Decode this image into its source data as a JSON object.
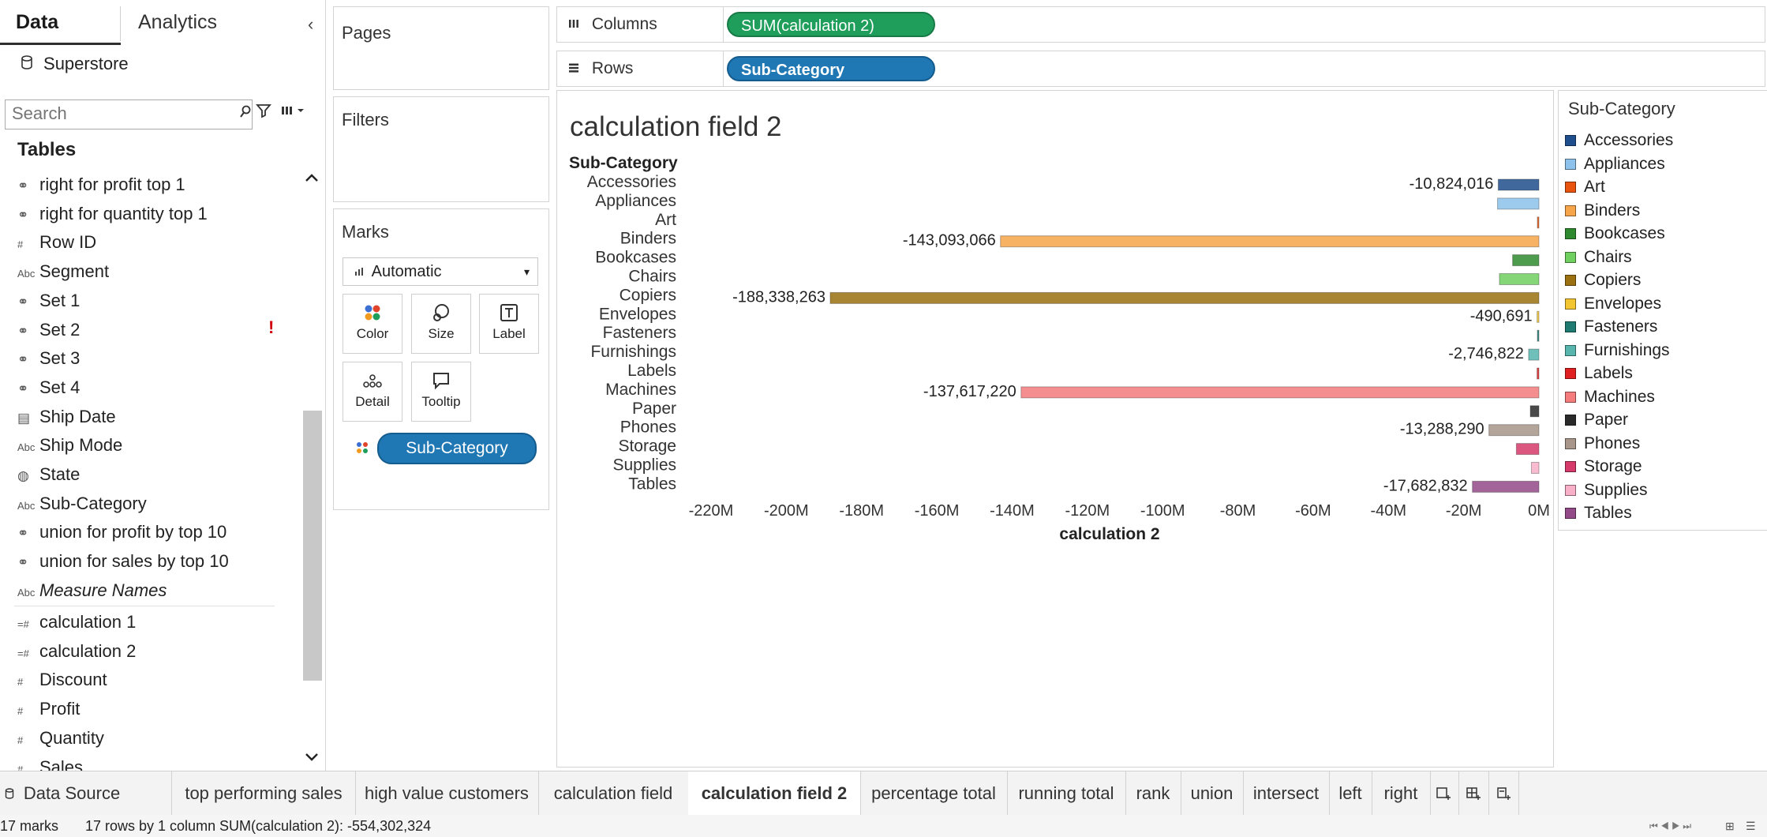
{
  "left_pane": {
    "tabs": {
      "data": "Data",
      "analytics": "Analytics"
    },
    "collapse_glyph": "‹",
    "datasource": "Superstore",
    "search_placeholder": "Search",
    "tables_header": "Tables",
    "fields": [
      {
        "icon": "link",
        "label": "right for profit top 1"
      },
      {
        "icon": "link",
        "label": "right for quantity top 1"
      },
      {
        "icon": "#",
        "label": "Row ID"
      },
      {
        "icon": "Abc",
        "label": "Segment"
      },
      {
        "icon": "link",
        "label": "Set 1"
      },
      {
        "icon": "link",
        "label": "Set 2"
      },
      {
        "icon": "link",
        "label": "Set 3"
      },
      {
        "icon": "link",
        "label": "Set 4"
      },
      {
        "icon": "date",
        "label": "Ship Date"
      },
      {
        "icon": "Abc",
        "label": "Ship Mode"
      },
      {
        "icon": "globe",
        "label": "State"
      },
      {
        "icon": "Abc",
        "label": "Sub-Category"
      },
      {
        "icon": "link",
        "label": "union for profit by top 10"
      },
      {
        "icon": "link",
        "label": "union for sales by top 10"
      },
      {
        "icon": "Abc",
        "label": "Measure Names",
        "italic": true
      },
      {
        "icon": "=#",
        "label": "calculation 1"
      },
      {
        "icon": "=#",
        "label": "calculation 2"
      },
      {
        "icon": "#",
        "label": "Discount"
      },
      {
        "icon": "#",
        "label": "Profit"
      },
      {
        "icon": "#",
        "label": "Quantity"
      },
      {
        "icon": "#",
        "label": "Sales"
      }
    ],
    "warning_glyph": "!"
  },
  "cards": {
    "pages": "Pages",
    "filters": "Filters",
    "marks": "Marks",
    "mark_type": "Automatic",
    "mark_buttons": [
      {
        "label": "Color",
        "icon": "color-icon"
      },
      {
        "label": "Size",
        "icon": "size-icon"
      },
      {
        "label": "Label",
        "icon": "label-icon"
      },
      {
        "label": "Detail",
        "icon": "detail-icon"
      },
      {
        "label": "Tooltip",
        "icon": "tooltip-icon"
      }
    ],
    "color_pill": "Sub-Category"
  },
  "shelves": {
    "columns_label": "Columns",
    "columns_pill": "SUM(calculation 2)",
    "rows_label": "Rows",
    "rows_pill": "Sub-Category"
  },
  "view": {
    "title": "calculation field 2"
  },
  "chart_data": {
    "type": "bar",
    "orientation": "horizontal",
    "row_header": "Sub-Category",
    "xlabel": "calculation 2",
    "xlim": [
      -220000000,
      0
    ],
    "x_ticks": [
      {
        "value": -220000000,
        "label": "-220M"
      },
      {
        "value": -200000000,
        "label": "-200M"
      },
      {
        "value": -180000000,
        "label": "-180M"
      },
      {
        "value": -160000000,
        "label": "-160M"
      },
      {
        "value": -140000000,
        "label": "-140M"
      },
      {
        "value": -120000000,
        "label": "-120M"
      },
      {
        "value": -100000000,
        "label": "-100M"
      },
      {
        "value": -80000000,
        "label": "-80M"
      },
      {
        "value": -60000000,
        "label": "-60M"
      },
      {
        "value": -40000000,
        "label": "-40M"
      },
      {
        "value": -20000000,
        "label": "-20M"
      },
      {
        "value": 0,
        "label": "0M"
      }
    ],
    "categories": [
      "Accessories",
      "Appliances",
      "Art",
      "Binders",
      "Bookcases",
      "Chairs",
      "Copiers",
      "Envelopes",
      "Fasteners",
      "Furnishings",
      "Labels",
      "Machines",
      "Paper",
      "Phones",
      "Storage",
      "Supplies",
      "Tables"
    ],
    "values": [
      -10824016,
      -11000000,
      -300000,
      -143093066,
      -7000000,
      -10500000,
      -188338263,
      -490691,
      -100000,
      -2746822,
      -500000,
      -137617220,
      -2300000,
      -13288290,
      -6000000,
      -2000000,
      -17682832
    ],
    "labels": [
      "-10,824,016",
      "",
      "",
      "-143,093,066",
      "",
      "",
      "-188,338,263",
      "-490,691",
      "",
      "-2,746,822",
      "",
      "-137,617,220",
      "",
      "-13,288,290",
      "",
      "",
      "-17,682,832"
    ],
    "colors": [
      "#1f4e8c",
      "#8cc2ec",
      "#e8530e",
      "#f6a54a",
      "#2f8a2f",
      "#6fcf5f",
      "#9a7010",
      "#f3c530",
      "#1f7a72",
      "#57b5ae",
      "#e02020",
      "#f47c7c",
      "#2a2a2a",
      "#a8968a",
      "#d63a6a",
      "#f7b0c8",
      "#934a88"
    ]
  },
  "legend": {
    "title": "Sub-Category",
    "items": [
      "Accessories",
      "Appliances",
      "Art",
      "Binders",
      "Bookcases",
      "Chairs",
      "Copiers",
      "Envelopes",
      "Fasteners",
      "Furnishings",
      "Labels",
      "Machines",
      "Paper",
      "Phones",
      "Storage",
      "Supplies",
      "Tables"
    ]
  },
  "sheet_tabs": {
    "data_source": "Data Source",
    "tabs": [
      "top performing sales",
      "high value customers",
      "calculation field",
      "calculation field 2",
      "percentage total",
      "running total",
      "rank",
      "union",
      "intersect",
      "left",
      "right"
    ],
    "active": "calculation field 2"
  },
  "status": {
    "marks": "17 marks",
    "rows_cols": "17 rows by 1 column",
    "sum": "SUM(calculation 2): -554,302,324"
  }
}
